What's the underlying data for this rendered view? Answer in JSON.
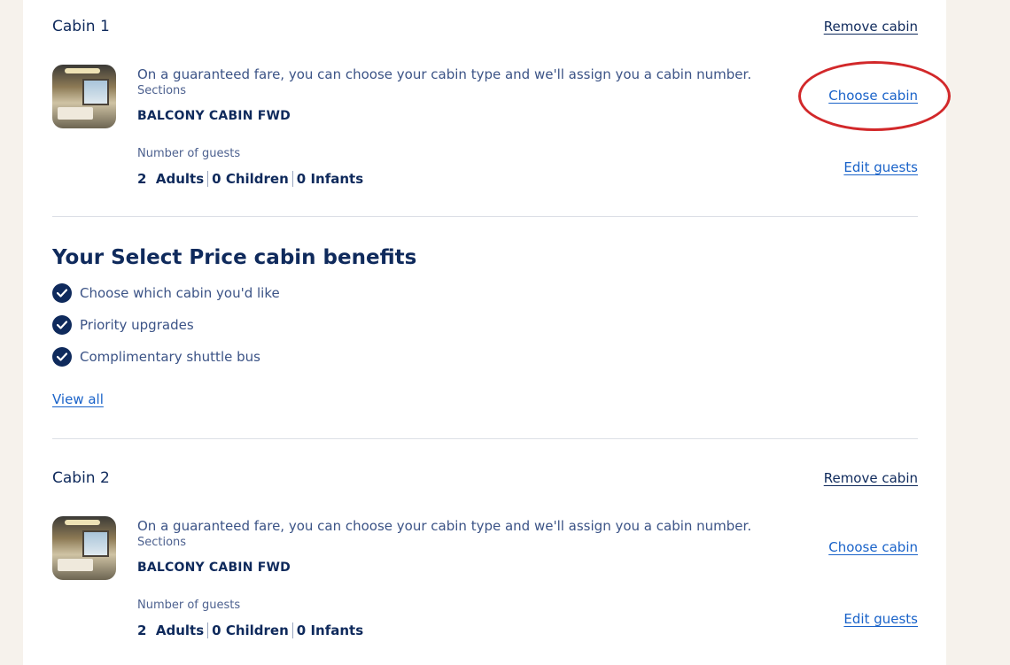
{
  "cabins": [
    {
      "title": "Cabin 1",
      "remove_label": "Remove cabin",
      "description": "On a guaranteed fare, you can choose your cabin type and we'll assign you a cabin number.",
      "sections_label": "Sections",
      "cabin_type": "BALCONY CABIN FWD",
      "choose_label": "Choose cabin",
      "guests_label": "Number of guests",
      "adults": "2  Adults",
      "children": "0 Children",
      "infants": "0 Infants",
      "edit_guests_label": "Edit guests"
    },
    {
      "title": "Cabin 2",
      "remove_label": "Remove cabin",
      "description": "On a guaranteed fare, you can choose your cabin type and we'll assign you a cabin number.",
      "sections_label": "Sections",
      "cabin_type": "BALCONY CABIN FWD",
      "choose_label": "Choose cabin",
      "guests_label": "Number of guests",
      "adults": "2  Adults",
      "children": "0 Children",
      "infants": "0 Infants",
      "edit_guests_label": "Edit guests"
    }
  ],
  "benefits": {
    "title": "Your Select Price cabin benefits",
    "items": [
      "Choose which cabin you'd like",
      "Priority upgrades",
      "Complimentary shuttle bus"
    ],
    "view_all_label": "View all"
  },
  "icons": {
    "benefit": "check-circle-icon"
  },
  "colors": {
    "navy": "#0f2a5c",
    "link_blue": "#1a63c9",
    "highlight_circle": "#d2282a",
    "background": "#f6f2ec"
  }
}
